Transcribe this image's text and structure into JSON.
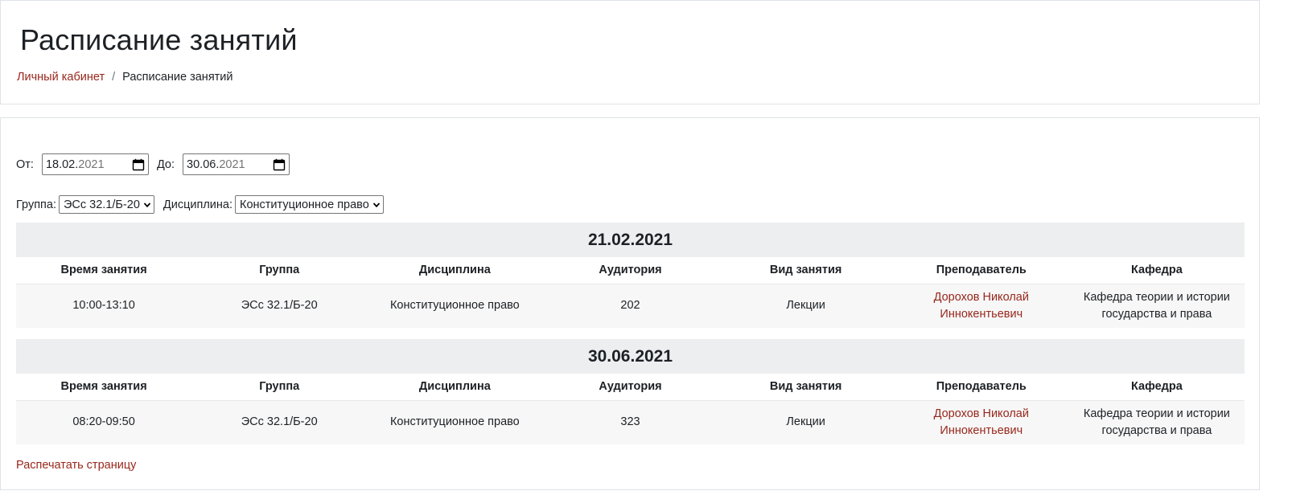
{
  "header": {
    "title": "Расписание занятий",
    "breadcrumb": {
      "home": "Личный кабинет",
      "separator": "/",
      "current": "Расписание занятий"
    }
  },
  "filters": {
    "from_label": "От:",
    "from_dm": "18.02.",
    "from_year": "2021",
    "to_label": "До:",
    "to_dm": "30.06.",
    "to_year": "2021",
    "group_label": "Группа:",
    "group_value": "ЭСс 32.1/Б-20",
    "discipline_label": "Дисциплина:",
    "discipline_value": "Конституционное право"
  },
  "columns": [
    "Время занятия",
    "Группа",
    "Дисциплина",
    "Аудитория",
    "Вид занятия",
    "Преподаватель",
    "Кафедра"
  ],
  "days": [
    {
      "date": "21.02.2021",
      "rows": [
        {
          "time": "10:00-13:10",
          "group": "ЭСс 32.1/Б-20",
          "discipline": "Конституционное право",
          "room": "202",
          "type": "Лекции",
          "teacher_line1": "Дорохов Николай",
          "teacher_line2": "Иннокентьевич",
          "dept_line1": "Кафедра теории и истории",
          "dept_line2": "государства и права"
        }
      ]
    },
    {
      "date": "30.06.2021",
      "rows": [
        {
          "time": "08:20-09:50",
          "group": "ЭСс 32.1/Б-20",
          "discipline": "Конституционное право",
          "room": "323",
          "type": "Лекции",
          "teacher_line1": "Дорохов Николай",
          "teacher_line2": "Иннокентьевич",
          "dept_line1": "Кафедра теории и истории",
          "dept_line2": "государства и права"
        }
      ]
    }
  ],
  "print_link": "Распечатать страницу",
  "colors": {
    "link": "#98271c",
    "day_header_bg": "#eceef0",
    "row_bg": "#f7f7f7"
  },
  "icons": [
    "calendar-icon",
    "chevron-down-icon"
  ]
}
